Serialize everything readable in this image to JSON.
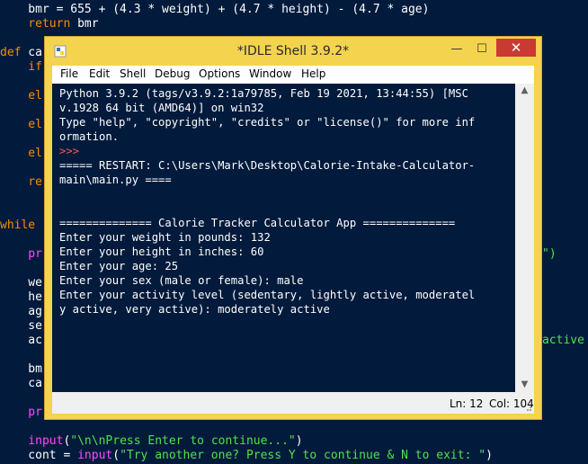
{
  "editor": {
    "lines": [
      {
        "a": "    bmr = 655 + (4.3 * weight) + (4.7 * height) - (4.7 * age)"
      },
      {
        "kw": "    return",
        "a": " bmr"
      },
      {
        "kw": "def",
        "a": " ca"
      },
      {
        "kw": "    if"
      },
      {
        "kw": "    el"
      },
      {
        "kw": "    el"
      },
      {
        "kw": "    el"
      },
      {
        "kw": "    re"
      },
      {
        "kw": "while"
      },
      {
        "fn": "    pr",
        "tail_str": "\")",
        "tail_fn": ""
      },
      {
        "a": "    we"
      },
      {
        "a": "    he"
      },
      {
        "a": "    ag"
      },
      {
        "a": "    se"
      },
      {
        "a": "    ac",
        "tail_str": "active"
      },
      {
        "a": "    bm"
      },
      {
        "a": "    ca"
      },
      {
        "fn": "    pr"
      },
      {
        "fn": "    input",
        "a": "(",
        "s": "\"\\n\\nPress Enter to continue...\"",
        "b": ")"
      },
      {
        "a": "    cont = ",
        "fn": "input",
        "b": "(",
        "s": "\"Try another one? Press Y to continue & N to exit: \"",
        "c": ")"
      }
    ]
  },
  "window": {
    "title": "*IDLE Shell 3.9.2*",
    "controls": {
      "minimize": "—",
      "maximize": "☐",
      "close": "✕"
    }
  },
  "menu": [
    "File",
    "Edit",
    "Shell",
    "Debug",
    "Options",
    "Window",
    "Help"
  ],
  "shell": {
    "banner1": "Python 3.9.2 (tags/v3.9.2:1a79785, Feb 19 2021, 13:44:55) [MSC",
    "banner2": "v.1928 64 bit (AMD64)] on win32",
    "banner3": "Type \"help\", \"copyright\", \"credits\" or \"license()\" for more inf",
    "banner4": "ormation.",
    "prompt": ">>>",
    "restart1": "===== RESTART: C:\\Users\\Mark\\Desktop\\Calorie-Intake-Calculator-",
    "restart2": "main\\main.py ====",
    "header": "============== Calorie Tracker Calculator App ==============",
    "q1": "Enter your weight in pounds: 132",
    "q2": "Enter your height in inches: 60",
    "q3": "Enter your age: 25",
    "q4": "Enter your sex (male or female): male",
    "q5a": "Enter your activity level (sedentary, lightly active, moderatel",
    "q5b": "y active, very active): moderately active"
  },
  "status": {
    "ln": "Ln: 12",
    "col": "Col: 104"
  },
  "colors": {
    "editor_bg": "#021a3b",
    "keyword": "#ff8b00",
    "string": "#4ee34e",
    "builtin": "#ff4bff",
    "window_frame": "#f4d34e",
    "close": "#c83a32",
    "prompt": "#ff5a5a"
  }
}
